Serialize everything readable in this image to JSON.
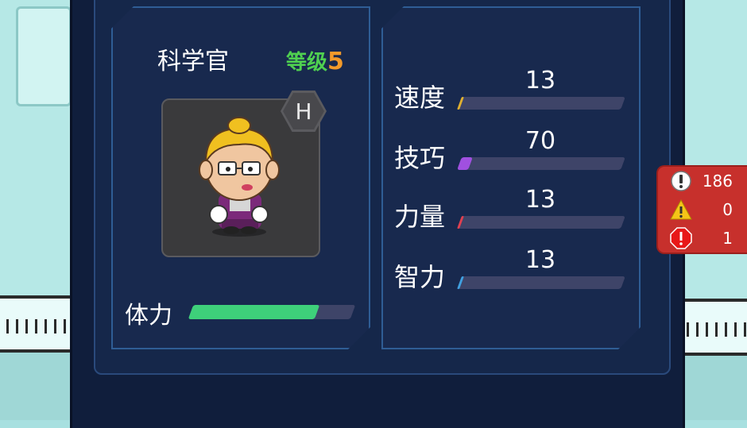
{
  "character": {
    "name": "科学官",
    "level_label": "等级",
    "level_value": "5",
    "rank_badge": "H",
    "stamina_label": "体力",
    "stamina_fraction": 0.78
  },
  "stats": [
    {
      "label": "速度",
      "value": "13",
      "fraction": 0.0,
      "accent": "#e0b030"
    },
    {
      "label": "技巧",
      "value": "70",
      "fraction": 0.07,
      "accent": "#a050e0"
    },
    {
      "label": "力量",
      "value": "13",
      "fraction": 0.0,
      "accent": "#e04050"
    },
    {
      "label": "智力",
      "value": "13",
      "fraction": 0.0,
      "accent": "#40a0e0"
    }
  ],
  "alerts": [
    {
      "icon": "info-circle-icon",
      "count": "186"
    },
    {
      "icon": "warning-triangle-icon",
      "count": "0"
    },
    {
      "icon": "error-octagon-icon",
      "count": "1"
    }
  ],
  "colors": {
    "stamina": "#3ed07a",
    "level_label": "#4fd050",
    "level_number": "#f39a2a",
    "alert_bg": "#c7302c"
  }
}
